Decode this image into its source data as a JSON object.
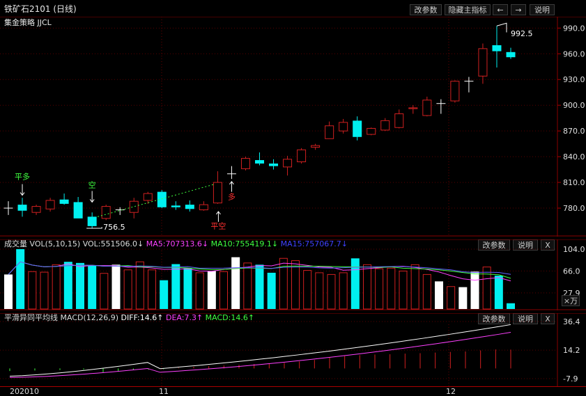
{
  "header": {
    "title": "铁矿石2101 (日线)",
    "strategy_label": "集金策略 JJCL",
    "btn_params": "改参数",
    "btn_hide": "隐藏主指标",
    "arrow_left": "←",
    "arrow_right": "→",
    "btn_help": "说明"
  },
  "main_chart": {
    "y_ticks": [
      "990.0",
      "960.0",
      "930.0",
      "900.0",
      "870.0",
      "840.0",
      "810.0",
      "780.0"
    ],
    "annotations": {
      "high": "992.5",
      "low": "756.5",
      "ping_duo": "平多",
      "kong": "空",
      "duo": "多",
      "ping_kong": "平空"
    },
    "colors": {
      "up": "#d02020",
      "down": "#00f0f0",
      "neutral": "#ffffff"
    }
  },
  "volume_panel": {
    "title": "成交量 VOL(5,10,15)",
    "vol": "VOL:551506.0↓",
    "ma5": "MA5:707313.6↓",
    "ma10": "MA10:755419.1↓",
    "ma15": "MA15:757067.7↓",
    "btn_params": "改参数",
    "btn_help": "说明",
    "btn_close": "X",
    "y_ticks": [
      "104.0",
      "66.0",
      "27.9"
    ],
    "unit": "×万"
  },
  "macd_panel": {
    "title": "平滑异同平均线 MACD(12,26,9)",
    "diff": "DIFF:14.6↑",
    "dea": "DEA:7.3↑",
    "macd": "MACD:14.6↑",
    "btn_params": "改参数",
    "btn_help": "说明",
    "btn_close": "X",
    "y_ticks": [
      "36.4",
      "14.2",
      "-7.9"
    ]
  },
  "x_axis": {
    "labels": [
      "202010",
      "11",
      "12"
    ]
  },
  "chart_data": {
    "type": "candlestick",
    "candles": [
      {
        "o": 780,
        "h": 788,
        "l": 772,
        "c": 780
      },
      {
        "o": 784,
        "h": 792,
        "l": 770,
        "c": 777
      },
      {
        "o": 775,
        "h": 784,
        "l": 772,
        "c": 782
      },
      {
        "o": 779,
        "h": 792,
        "l": 776,
        "c": 789
      },
      {
        "o": 790,
        "h": 797,
        "l": 784,
        "c": 785
      },
      {
        "o": 787,
        "h": 793,
        "l": 770,
        "c": 768
      },
      {
        "o": 770,
        "h": 775,
        "l": 756.5,
        "c": 759
      },
      {
        "o": 768,
        "h": 784,
        "l": 766,
        "c": 782
      },
      {
        "o": 778,
        "h": 781,
        "l": 772,
        "c": 778
      },
      {
        "o": 775,
        "h": 792,
        "l": 768,
        "c": 788
      },
      {
        "o": 789,
        "h": 799,
        "l": 785,
        "c": 797
      },
      {
        "o": 799,
        "h": 801,
        "l": 780,
        "c": 781
      },
      {
        "o": 783,
        "h": 788,
        "l": 778,
        "c": 781
      },
      {
        "o": 784,
        "h": 789,
        "l": 776,
        "c": 779
      },
      {
        "o": 778,
        "h": 788,
        "l": 777,
        "c": 784
      },
      {
        "o": 786,
        "h": 823,
        "l": 785,
        "c": 810
      },
      {
        "o": 820,
        "h": 829,
        "l": 814,
        "c": 820
      },
      {
        "o": 826,
        "h": 840,
        "l": 824,
        "c": 838
      },
      {
        "o": 836,
        "h": 845,
        "l": 830,
        "c": 832
      },
      {
        "o": 832,
        "h": 837,
        "l": 825,
        "c": 829
      },
      {
        "o": 828,
        "h": 841,
        "l": 818,
        "c": 837
      },
      {
        "o": 834,
        "h": 850,
        "l": 832,
        "c": 848
      },
      {
        "o": 851,
        "h": 855,
        "l": 848,
        "c": 853
      },
      {
        "o": 861,
        "h": 881,
        "l": 861,
        "c": 876
      },
      {
        "o": 870,
        "h": 884,
        "l": 867,
        "c": 880
      },
      {
        "o": 882,
        "h": 887,
        "l": 859,
        "c": 863
      },
      {
        "o": 866,
        "h": 874,
        "l": 865,
        "c": 873
      },
      {
        "o": 871,
        "h": 885,
        "l": 870,
        "c": 882
      },
      {
        "o": 874,
        "h": 895,
        "l": 873,
        "c": 890
      },
      {
        "o": 896,
        "h": 900,
        "l": 890,
        "c": 897
      },
      {
        "o": 888,
        "h": 910,
        "l": 887,
        "c": 906
      },
      {
        "o": 902,
        "h": 907,
        "l": 890,
        "c": 902
      },
      {
        "o": 905,
        "h": 929,
        "l": 903,
        "c": 928
      },
      {
        "o": 928,
        "h": 933,
        "l": 915,
        "c": 928
      },
      {
        "o": 934,
        "h": 972,
        "l": 925,
        "c": 966
      },
      {
        "o": 970,
        "h": 992.5,
        "l": 944,
        "c": 963
      },
      {
        "o": 962,
        "h": 967,
        "l": 954,
        "c": 956
      }
    ],
    "volume_wan": [
      60,
      104,
      65,
      64,
      77,
      82,
      80,
      76,
      62,
      77,
      68,
      82,
      68,
      50,
      78,
      71,
      63,
      66,
      65,
      90,
      80,
      77,
      63,
      88,
      84,
      67,
      63,
      60,
      63,
      88,
      77,
      70,
      71,
      66,
      77,
      60,
      48,
      39,
      38,
      65,
      73,
      58,
      10
    ],
    "macd_hist": [
      -3.0,
      -2.0,
      -1.4,
      -1.0,
      -0.6,
      0.5,
      1.3,
      1.8,
      2.3,
      2.8,
      3.4,
      3.8,
      4.3,
      5.4,
      6.6,
      8.4,
      9.6,
      10.3,
      10.8,
      11.0,
      11.5,
      11.8,
      12.3,
      12.8,
      13.2,
      14.0,
      14.7,
      14.6
    ],
    "diff_range": [
      -7.9,
      36.4
    ],
    "y_range": [
      750,
      1000
    ]
  }
}
